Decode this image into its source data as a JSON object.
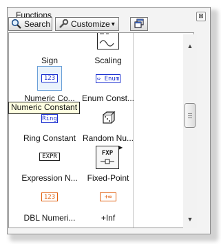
{
  "window": {
    "title": "Functions",
    "close_glyph": "⊠"
  },
  "toolbar": {
    "search_label": "Search",
    "customize_label": "Customize",
    "customize_arrow": "▾"
  },
  "palette": {
    "top_row": [
      {
        "label": "Sign"
      },
      {
        "label": "Scaling"
      }
    ],
    "items": [
      {
        "label": "Numeric Co...",
        "glyph": "123"
      },
      {
        "label": "Enum Const...",
        "glyph": "⇔ Enum"
      },
      {
        "label": "Ring Constant",
        "glyph": "Ring"
      },
      {
        "label": "Random Nu...",
        "glyph": ""
      },
      {
        "label": "Expression N...",
        "glyph": "EXPR"
      },
      {
        "label": "Fixed-Point",
        "glyph": "FXP"
      },
      {
        "label": "DBL Numeri...",
        "glyph": "123"
      },
      {
        "label": "+Inf",
        "glyph": "+∞"
      }
    ]
  },
  "tooltip": {
    "text": "Numeric Constant"
  },
  "scrollbar": {
    "up_glyph": "▲",
    "down_glyph": "▼"
  },
  "colors": {
    "numeric_blue": "#1a2fd0",
    "dbl_orange": "#e06010",
    "tooltip_bg": "#ffffe1"
  }
}
